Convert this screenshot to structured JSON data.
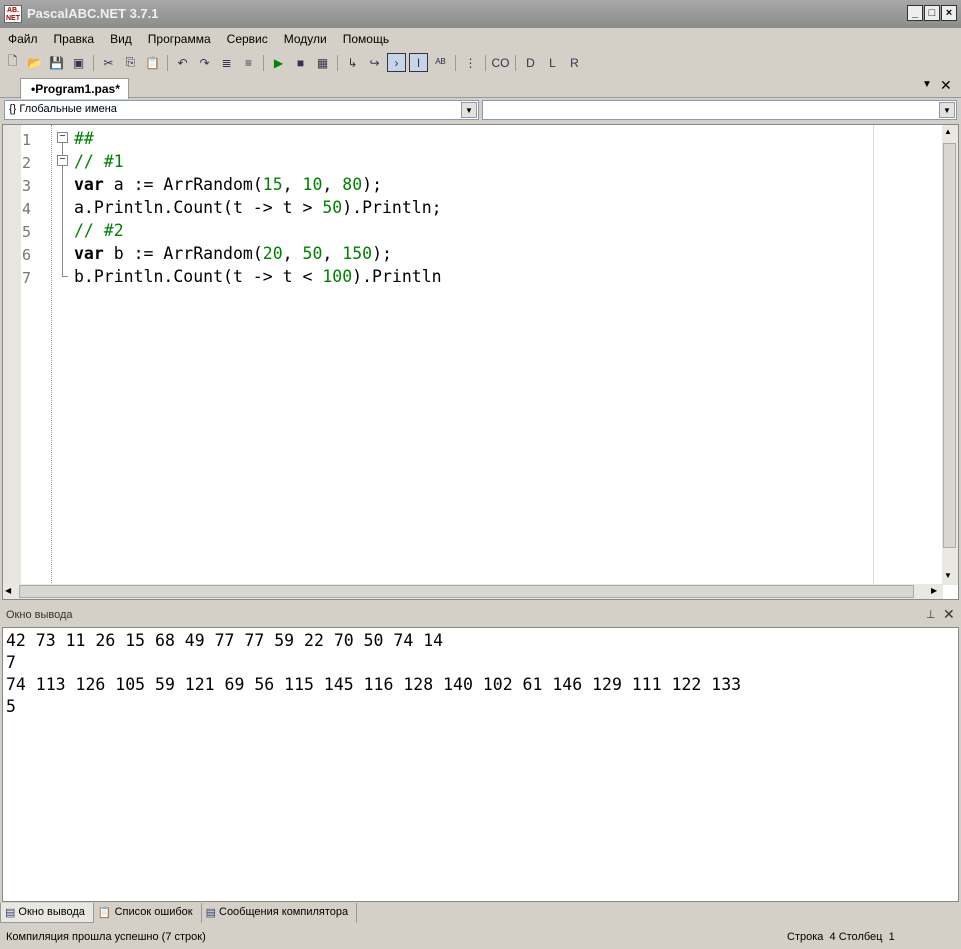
{
  "window": {
    "title": "PascalABC.NET 3.7.1",
    "app_icon_text": "AB.NET"
  },
  "menu": [
    "Файл",
    "Правка",
    "Вид",
    "Программа",
    "Сервис",
    "Модули",
    "Помощь"
  ],
  "toolbar": [
    "new-file",
    "open",
    "save",
    "save-all",
    "|",
    "cut",
    "copy",
    "paste",
    "|",
    "undo",
    "redo",
    "format",
    "format2",
    "|",
    "run",
    "stop",
    "debug",
    "|",
    "step-into",
    "step-over",
    "toggle-output-on",
    "toggle-insert-on",
    "spell",
    "|",
    "navigate",
    "|",
    "code",
    "|",
    "D",
    "L",
    "R"
  ],
  "tab": {
    "label": "•Program1.pas*"
  },
  "scope_select": {
    "value": "Глобальные имена",
    "right_value": ""
  },
  "editor": {
    "lines": [
      [
        [
          "cm",
          "##"
        ]
      ],
      [
        [
          "cm",
          "// #1"
        ]
      ],
      [
        [
          "kw",
          "var"
        ],
        [
          "t",
          " a := ArrRandom("
        ],
        [
          "num",
          "15"
        ],
        [
          "t",
          ", "
        ],
        [
          "num",
          "10"
        ],
        [
          "t",
          ", "
        ],
        [
          "num",
          "80"
        ],
        [
          "t",
          ");"
        ]
      ],
      [
        [
          "t",
          "a.Println.Count(t -> t > "
        ],
        [
          "num",
          "50"
        ],
        [
          "t",
          ").Println;"
        ]
      ],
      [
        [
          "cm",
          "// #2"
        ]
      ],
      [
        [
          "kw",
          "var"
        ],
        [
          "t",
          " b := ArrRandom("
        ],
        [
          "num",
          "20"
        ],
        [
          "t",
          ", "
        ],
        [
          "num",
          "50"
        ],
        [
          "t",
          ", "
        ],
        [
          "num",
          "150"
        ],
        [
          "t",
          ");"
        ]
      ],
      [
        [
          "t",
          "b.Println.Count(t -> t < "
        ],
        [
          "num",
          "100"
        ],
        [
          "t",
          ").Println"
        ]
      ]
    ]
  },
  "output_panel": {
    "title": "Окно вывода",
    "lines": [
      "42 73 11 26 15 68 49 77 77 59 22 70 50 74 14",
      "7",
      "74 113 126 105 59 121 69 56 115 145 116 128 140 102 61 146 129 111 122 133",
      "5"
    ]
  },
  "bottom_tabs": [
    "Окно вывода",
    "Список ошибок",
    "Сообщения компилятора"
  ],
  "status": {
    "message": "Компиляция прошла успешно (7 строк)",
    "row_label": "Строка",
    "row": "4",
    "col_label": "Столбец",
    "col": "1"
  }
}
